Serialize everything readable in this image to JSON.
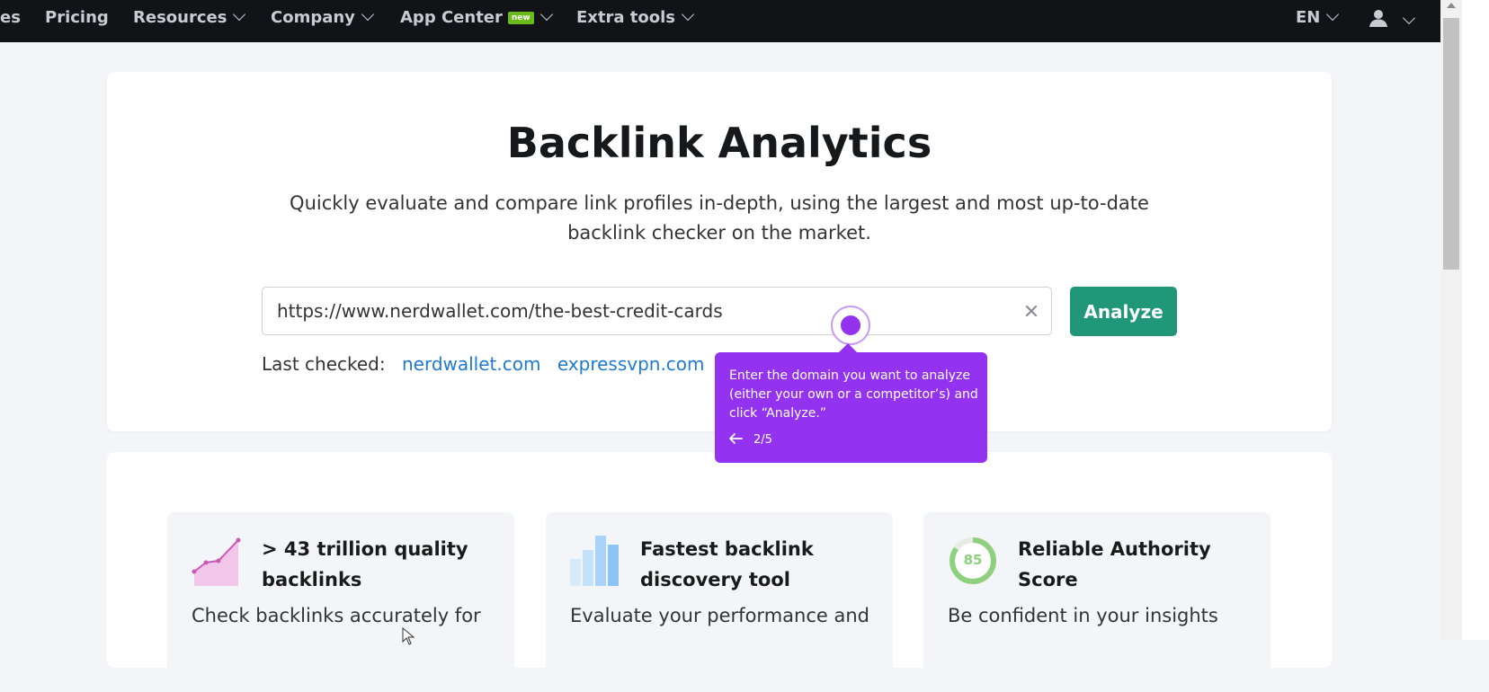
{
  "nav": {
    "items": [
      {
        "label": "es"
      },
      {
        "label": "Pricing"
      },
      {
        "label": "Resources"
      },
      {
        "label": "Company"
      },
      {
        "label": "App Center",
        "badge": "new"
      },
      {
        "label": "Extra tools"
      }
    ],
    "language": "EN",
    "user_icon": "user-icon"
  },
  "hero": {
    "title": "Backlink Analytics",
    "subtitle": "Quickly evaluate and compare link profiles in-depth, using the largest and most up-to-date backlink checker on the market.",
    "url_value": "https://www.nerdwallet.com/the-best-credit-cards",
    "analyze_label": "Analyze",
    "last_checked_label": "Last checked:",
    "last_checked_links": [
      "nerdwallet.com",
      "expressvpn.com"
    ]
  },
  "tooltip": {
    "text": "Enter the domain you want to analyze (either your own or a competitor’s) and click “Analyze.”",
    "step": "2/5",
    "back_icon": "arrow-left-icon"
  },
  "features": [
    {
      "icon": "line-chart-icon",
      "title": "> 43 trillion quality backlinks",
      "text": "Check backlinks accurately for"
    },
    {
      "icon": "bar-chart-icon",
      "title": "Fastest backlink discovery tool",
      "text": "Evaluate your performance and"
    },
    {
      "icon": "authority-score-icon",
      "score": "85",
      "title": "Reliable Authority Score",
      "text": "Be confident in your insights"
    }
  ],
  "colors": {
    "nav_bg": "#121316",
    "accent_green": "#21977a",
    "link_blue": "#1f7ad2",
    "tooltip_purple": "#9433ef",
    "badge_green": "#6aba1c"
  }
}
